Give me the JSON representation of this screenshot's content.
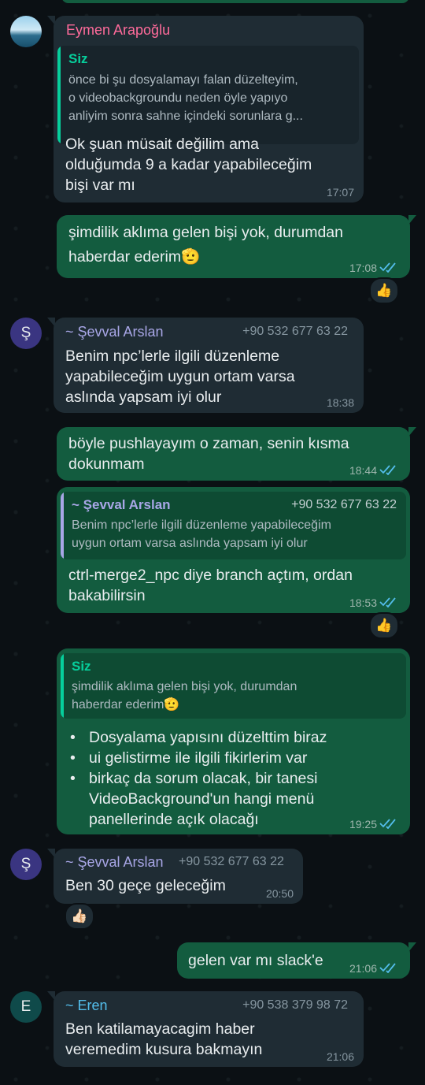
{
  "colors": {
    "background": "#0b1014",
    "incoming_bubble": "#1f2c34",
    "outgoing_bubble": "#135c3f",
    "read_tick": "#53bdeb",
    "quote_bar_self": "#06cf9c",
    "quote_bar_sevval": "#a8a6e6",
    "name_eymen": "#ff6b9b",
    "name_sevval": "#a8a6e6",
    "name_eren": "#53bdeb"
  },
  "messages": [
    {
      "sender": "Eymen Arapoğlu",
      "quote_author": "Siz",
      "quote_lines": [
        "önce bi şu dosyalamayı falan düzelteyim,",
        "o videobackgroundu neden öyle yapıyo",
        "anliyim sonra sahne içindeki sorunlara g..."
      ],
      "lines": [
        "Ok şuan müsait değilim ama",
        "olduğumda 9 a kadar yapabileceğim",
        "bişi var mı"
      ],
      "time": "17:07"
    },
    {
      "lines": [
        "şimdilik aklıma gelen bişi yok, durumdan",
        "haberdar ederim🫡"
      ],
      "time": "17:08",
      "reaction": "👍"
    },
    {
      "avatar_letter": "Ş",
      "sender": "~ Şevval Arslan",
      "phone": "+90 532 677 63 22",
      "lines": [
        "Benim npc’lerle ilgili düzenleme",
        "yapabileceğim uygun ortam varsa",
        "aslında yapsam iyi olur"
      ],
      "time": "18:38"
    },
    {
      "lines": [
        "böyle pushlayayım o zaman, senin kısma",
        "dokunmam"
      ],
      "time": "18:44"
    },
    {
      "quote_author": "~ Şevval Arslan",
      "quote_phone": "+90 532 677 63 22",
      "quote_lines": [
        "Benim npc’lerle ilgili düzenleme yapabileceğim",
        "uygun ortam varsa aslında yapsam iyi olur"
      ],
      "lines": [
        "ctrl-merge2_npc diye branch açtım, ordan",
        "bakabilirsin"
      ],
      "time": "18:53",
      "reaction": "👍"
    },
    {
      "quote_author": "Siz",
      "quote_lines": [
        "şimdilik aklıma gelen bişi yok, durumdan",
        "haberdar ederim🫡"
      ],
      "bullets": [
        "Dosyalama yapısını düzelttim biraz",
        "ui gelistirme ile ilgili fikirlerim var",
        "birkaç da sorum olacak, bir tanesi",
        "VideoBackground'un hangi menü",
        "panellerinde açık olacağı"
      ],
      "time": "19:25"
    },
    {
      "avatar_letter": "Ş",
      "sender": "~ Şevval Arslan",
      "phone": "+90 532 677 63 22",
      "lines": [
        "Ben 30 geçe geleceğim"
      ],
      "time": "20:50",
      "reaction": "👍🏻"
    },
    {
      "lines": [
        "gelen var mı slack'e"
      ],
      "time": "21:06"
    },
    {
      "avatar_letter": "E",
      "sender": "~ Eren",
      "phone": "+90 538 379 98 72",
      "lines": [
        "Ben katilamayacagim haber",
        "veremedim kusura bakmayın"
      ],
      "time": "21:06"
    }
  ]
}
